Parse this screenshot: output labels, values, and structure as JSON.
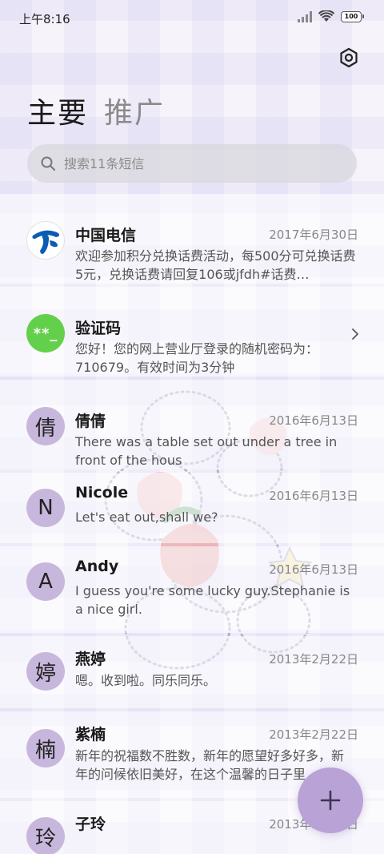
{
  "status_bar": {
    "time": "上午8:16",
    "battery": "100"
  },
  "tabs": [
    {
      "label": "主要",
      "active": true
    },
    {
      "label": "推广",
      "active": false
    }
  ],
  "search": {
    "placeholder": "搜索11条短信"
  },
  "conversations": [
    {
      "name": "中国电信",
      "date": "2017年6月30日",
      "preview": "欢迎参加积分兑换话费活动，每500分可兑换话费5元，兑换话费请回复106或jfdh#话费…",
      "avatar": "telecom-logo"
    },
    {
      "name": "验证码",
      "date": "",
      "preview": "您好！您的网上营业厅登录的随机密码为：710679。有效时间为3分钟",
      "avatar_text": "**_"
    },
    {
      "name": "倩倩",
      "date": "2016年6月13日",
      "preview": "There was a table set out under a tree in front of the hous",
      "avatar_text": "倩"
    },
    {
      "name": "Nicole",
      "date": "2016年6月13日",
      "preview": "Let's eat out,shall we?",
      "avatar_text": "N"
    },
    {
      "name": "Andy",
      "date": "2016年6月13日",
      "preview": "I guess you're some lucky guy.Stephanie is a nice girl.",
      "avatar_text": "A"
    },
    {
      "name": "燕婷",
      "date": "2013年2月22日",
      "preview": "嗯。收到啦。同乐同乐。",
      "avatar_text": "婷"
    },
    {
      "name": "紫楠",
      "date": "2013年2月22日",
      "preview": "新年的祝福数不胜数，新年的愿望好多好多，新年的问候依旧美好，在这个温馨的日子里",
      "avatar_text": "楠"
    },
    {
      "name": "子玲",
      "date": "2013年2月22日",
      "preview": "",
      "avatar_text": "玲"
    }
  ],
  "colors": {
    "accent": "#b9a3d6",
    "avatar_purple": "#c8b7dc",
    "avatar_green": "#62d04a",
    "telecom_blue": "#0b5db3"
  },
  "icons": {
    "settings": "gear-icon",
    "search": "search-icon",
    "fab": "plus-icon",
    "chevron": "chevron-right-icon"
  }
}
